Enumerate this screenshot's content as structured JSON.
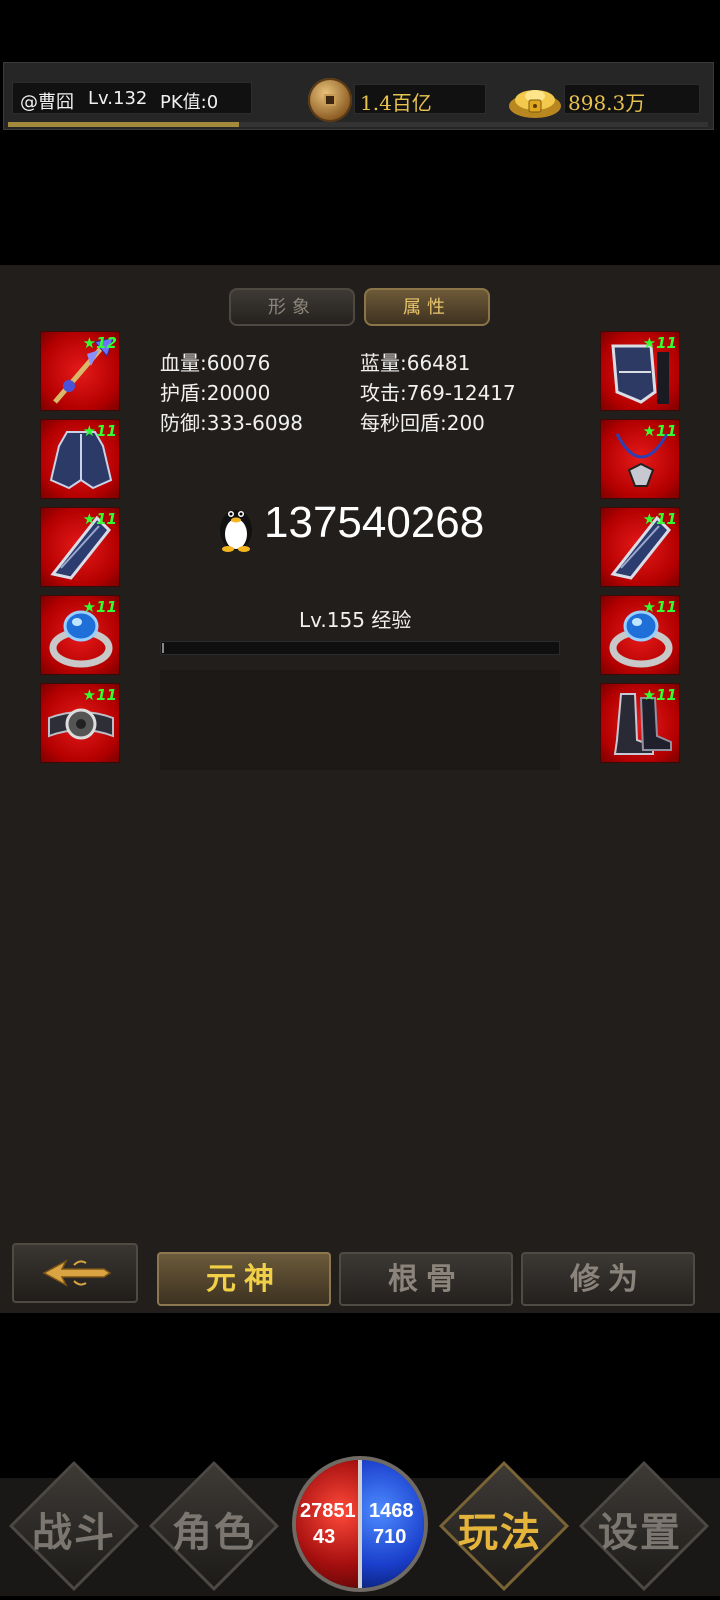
{
  "topbar": {
    "player_name": "@曹囧",
    "player_level": "Lv.132",
    "player_pk": "PK值:0",
    "copper": "1.4百亿",
    "gold_ingot": "898.3万",
    "exp_progress": 0.33
  },
  "tabs": {
    "look": "形象",
    "attributes": "属性"
  },
  "equipment_left": [
    {
      "name": "weapon",
      "stars": "12"
    },
    {
      "name": "armor",
      "stars": "11"
    },
    {
      "name": "bracer",
      "stars": "11"
    },
    {
      "name": "ring",
      "stars": "11"
    },
    {
      "name": "belt",
      "stars": "11"
    }
  ],
  "equipment_right": [
    {
      "name": "helmet",
      "stars": "11"
    },
    {
      "name": "necklace",
      "stars": "11"
    },
    {
      "name": "bracer",
      "stars": "11"
    },
    {
      "name": "ring",
      "stars": "11"
    },
    {
      "name": "boots",
      "stars": "11"
    }
  ],
  "stats": {
    "hp": "血量:60076",
    "mp": "蓝量:66481",
    "shield": "护盾:20000",
    "attack": "攻击:769-12417",
    "defense": "防御:333-6098",
    "shield_regen": "每秒回盾:200"
  },
  "qq": {
    "icon": "penguin-icon",
    "number": "137540268"
  },
  "spirit": {
    "level_label": "Lv.155  经验",
    "exp_progress": 0.005
  },
  "bottom_tabs": {
    "spirit": "元神",
    "bone": "根骨",
    "cultivation": "修为"
  },
  "nav": {
    "battle": "战斗",
    "character": "角色",
    "gameplay": "玩法",
    "settings": "设置",
    "hp_top": "27851",
    "hp_bottom": "43",
    "mp_top": "1468",
    "mp_bottom": "710"
  },
  "colors": {
    "accent_gold": "#e8c24f",
    "star_green": "#33ff33",
    "slot_red": "#d10000"
  }
}
